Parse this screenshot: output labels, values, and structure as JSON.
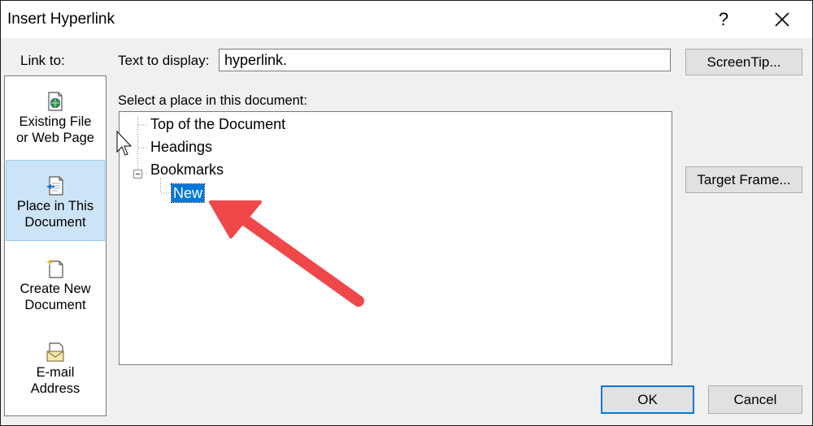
{
  "window": {
    "title": "Insert Hyperlink",
    "help_label": "?"
  },
  "sidebar": {
    "heading": "Link to:",
    "items": [
      {
        "label": "Existing File\nor Web Page",
        "icon": "globe-document-icon",
        "selected": false
      },
      {
        "label": "Place in This\nDocument",
        "icon": "document-arrow-icon",
        "selected": true
      },
      {
        "label": "Create New\nDocument",
        "icon": "new-document-icon",
        "selected": false
      },
      {
        "label": "E-mail\nAddress",
        "icon": "envelope-icon",
        "selected": false
      }
    ]
  },
  "display": {
    "label": "Text to display:",
    "value": "hyperlink."
  },
  "buttons": {
    "screentip": "ScreenTip...",
    "target_frame": "Target Frame...",
    "ok": "OK",
    "cancel": "Cancel"
  },
  "place": {
    "label": "Select a place in this document:",
    "nodes": [
      {
        "label": "Top of the Document"
      },
      {
        "label": "Headings"
      },
      {
        "label": "Bookmarks",
        "expanded": true
      },
      {
        "label": "New",
        "selected": true
      }
    ]
  },
  "colors": {
    "selection": "#0078d7",
    "sidebar_selected": "#cce4f7",
    "annotation_arrow": "#f0474b"
  }
}
